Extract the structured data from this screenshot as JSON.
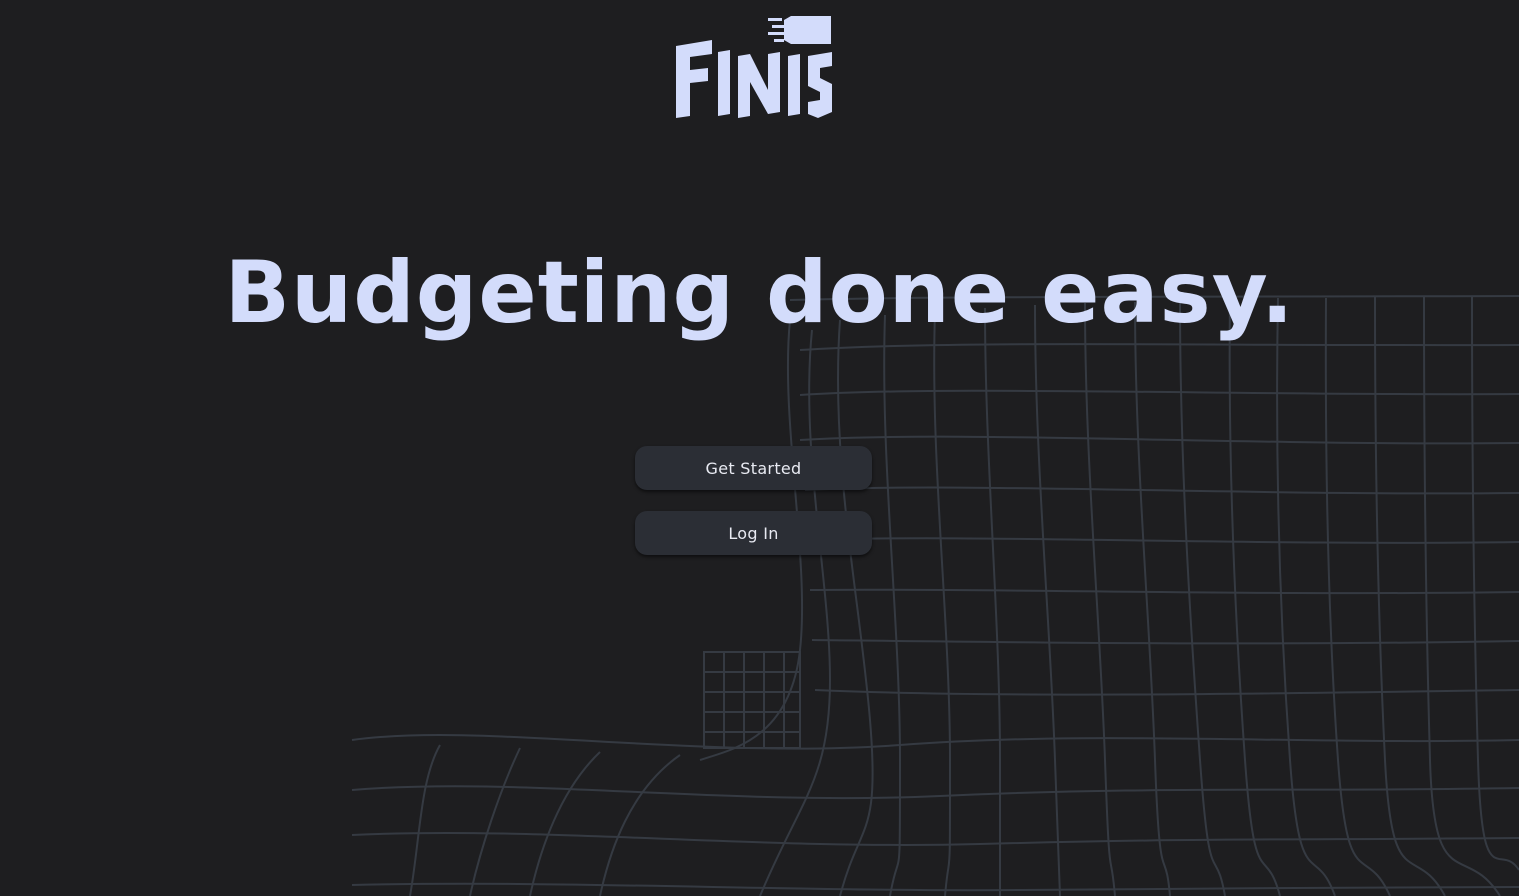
{
  "brand": {
    "name": "Finis",
    "logo_color": "#d3dcfb"
  },
  "hero": {
    "headline": "Budgeting done easy."
  },
  "actions": {
    "get_started_label": "Get Started",
    "log_in_label": "Log In"
  },
  "theme": {
    "background": "#1e1e20",
    "button_background": "#2b2e35",
    "button_text": "#e8eaf2",
    "grid_line": "#353a42"
  }
}
